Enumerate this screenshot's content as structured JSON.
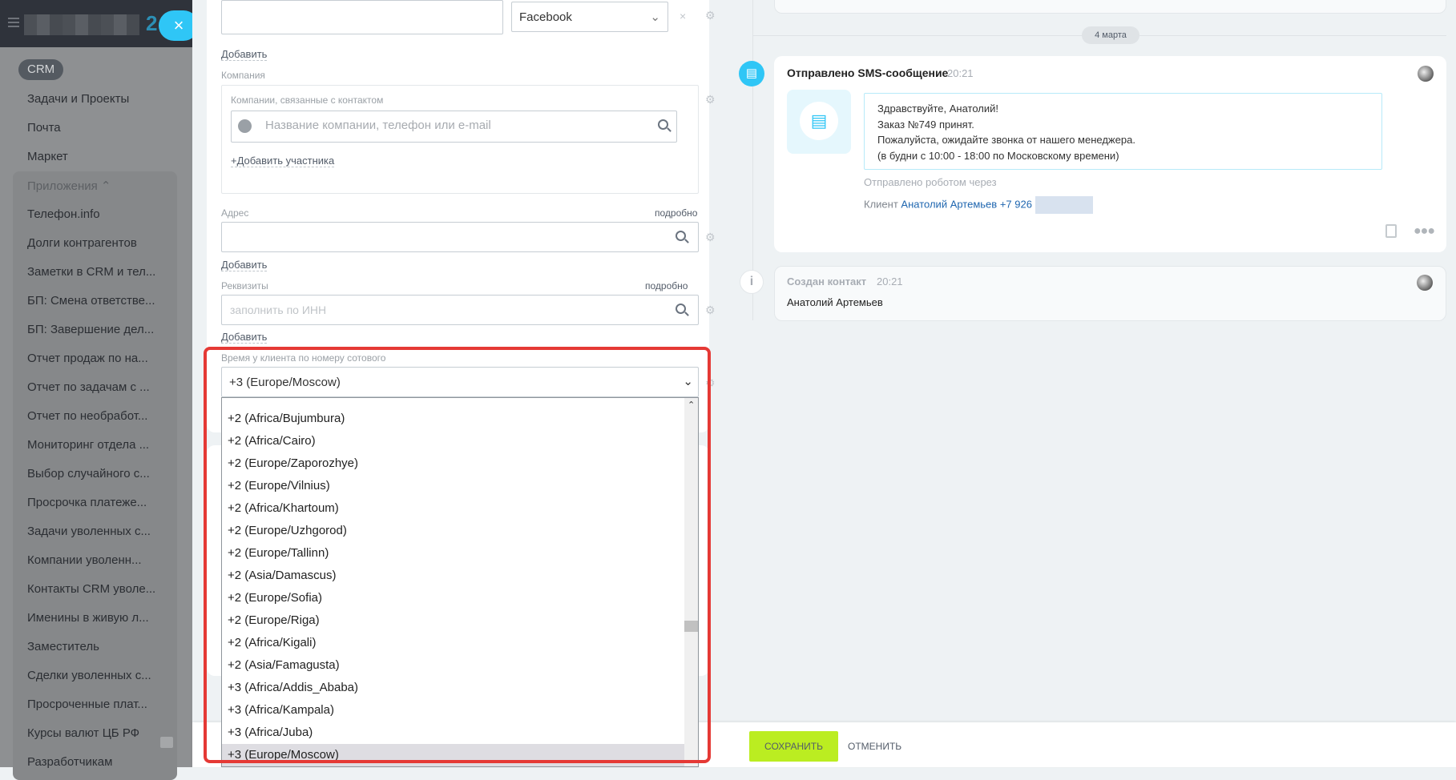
{
  "sidebar": {
    "logo_suffix": "2",
    "close_icon": "×",
    "crm": "CRM",
    "items": [
      "Задачи и Проекты",
      "Почта",
      "Маркет"
    ],
    "apps_title": "Приложения ⌃",
    "apps": [
      "Телефон.info",
      "Долги контрагентов",
      "Заметки в CRM и тел...",
      "БП: Смена ответстве...",
      "БП: Завершение дел...",
      "Отчет продаж по на...",
      "Отчет по задачам с ...",
      "Отчет по необработ...",
      "Мониторинг отдела ...",
      "Выбор случайного с...",
      "Просрочка платеже...",
      "Задачи уволенных с...",
      "Компании уволенн...",
      "Контакты CRM уволе...",
      "Именины в живую л...",
      "Заместитель",
      "Сделки уволенных с...",
      "Просроченные плат...",
      "Курсы валют ЦБ РФ",
      "Разработчикам"
    ]
  },
  "form": {
    "messenger_select": "Facebook",
    "add1": "Добавить",
    "company_label": "Компания",
    "company_box_label": "Компании, связанные с контактом",
    "company_placeholder": "Название компании, телефон или e-mail",
    "add_participant": "+Добавить участника",
    "address_label": "Адрес",
    "details1": "подробно",
    "add2": "Добавить",
    "requisites_label": "Реквизиты",
    "details2": "подробно",
    "requisites_placeholder": "заполнить по ИНН",
    "add3": "Добавить",
    "timezone_label": "Время у клиента по номеру сотового",
    "timezone_value": "+3 (Europe/Moscow)",
    "timezone_options": [
      "+2 (Africa/Bujumbura)",
      "+2 (Africa/Cairo)",
      "+2 (Europe/Zaporozhye)",
      "+2 (Europe/Vilnius)",
      "+2 (Africa/Khartoum)",
      "+2 (Europe/Uzhgorod)",
      "+2 (Europe/Tallinn)",
      "+2 (Asia/Damascus)",
      "+2 (Europe/Sofia)",
      "+2 (Europe/Riga)",
      "+2 (Africa/Kigali)",
      "+2 (Asia/Famagusta)",
      "+3 (Africa/Addis_Ababa)",
      "+3 (Africa/Kampala)",
      "+3 (Africa/Juba)",
      "+3 (Europe/Moscow)"
    ],
    "selected_index": 15
  },
  "footer": {
    "save": "СОХРАНИТЬ",
    "cancel": "ОТМЕНИТЬ"
  },
  "timeline": {
    "date": "4 марта",
    "sms": {
      "title": "Отправлено SMS-сообщение",
      "time": "20:21",
      "lines": [
        "Здравствуйте, Анатолий!",
        "Заказ №749 принят.",
        "Пожалуйста, ожидайте звонка от нашего менеджера.",
        "(в будни с 10:00 - 18:00 по Московскому времени)"
      ],
      "sent_by": "Отправлено роботом через",
      "client_label": "Клиент",
      "client_name": "Анатолий Артемьев",
      "client_phone": "+7 926"
    },
    "created": {
      "title": "Создан контакт",
      "time": "20:21",
      "name": "Анатолий Артемьев"
    }
  },
  "colors": {
    "accent": "#2fc6f6",
    "save": "#bbed21",
    "highlight": "#e53935",
    "link": "#2067b0"
  }
}
